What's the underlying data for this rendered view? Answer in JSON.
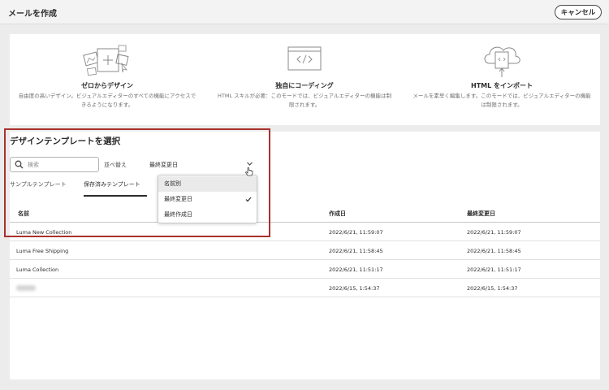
{
  "header": {
    "title": "メールを作成",
    "cancel_label": "キャンセル"
  },
  "options": [
    {
      "title": "ゼロからデザイン",
      "description": "自由度の高いデザイン。ビジュアルエディターのすべての機能にアクセスできるようになります。",
      "icon": "design-from-scratch-illustration"
    },
    {
      "title": "独自にコーディング",
      "description": "HTML スキルが必要：このモードでは、ビジュアルエディターの機能は制限されます。",
      "icon": "code-editor-illustration"
    },
    {
      "title": "HTML をインポート",
      "description": "メールを素早く編集します。このモードでは、ビジュアルエディターの機能は制限されます。",
      "icon": "import-html-illustration"
    }
  ],
  "templates": {
    "title": "デザインテンプレートを選択",
    "search_placeholder": "検索",
    "sort_label": "並べ替え",
    "sort_value": "最終変更日",
    "tabs": [
      {
        "label": "サンプルテンプレート",
        "active": false
      },
      {
        "label": "保存済みテンプレート",
        "active": true
      }
    ],
    "sort_options": [
      {
        "label": "名前別",
        "selected": false
      },
      {
        "label": "最終変更日",
        "selected": true
      },
      {
        "label": "最終作成日",
        "selected": false
      }
    ],
    "columns": {
      "name": "名前",
      "created": "作成日",
      "modified": "最終変更日"
    },
    "rows": [
      {
        "name": "Luma New Collection",
        "created": "2022/6/21, 11:59:07",
        "modified": "2022/6/21, 11:59:07"
      },
      {
        "name": "Luma Free Shipping",
        "created": "2022/6/21, 11:58:45",
        "modified": "2022/6/21, 11:58:45"
      },
      {
        "name": "Luma Collection",
        "created": "2022/6/21, 11:51:17",
        "modified": "2022/6/21, 11:51:17"
      },
      {
        "name": "",
        "created": "2022/6/15, 1:54:37",
        "modified": "2022/6/15, 1:54:37"
      }
    ]
  },
  "colors": {
    "highlight": "#a8322d",
    "background": "#ececec",
    "panel": "#ffffff"
  }
}
